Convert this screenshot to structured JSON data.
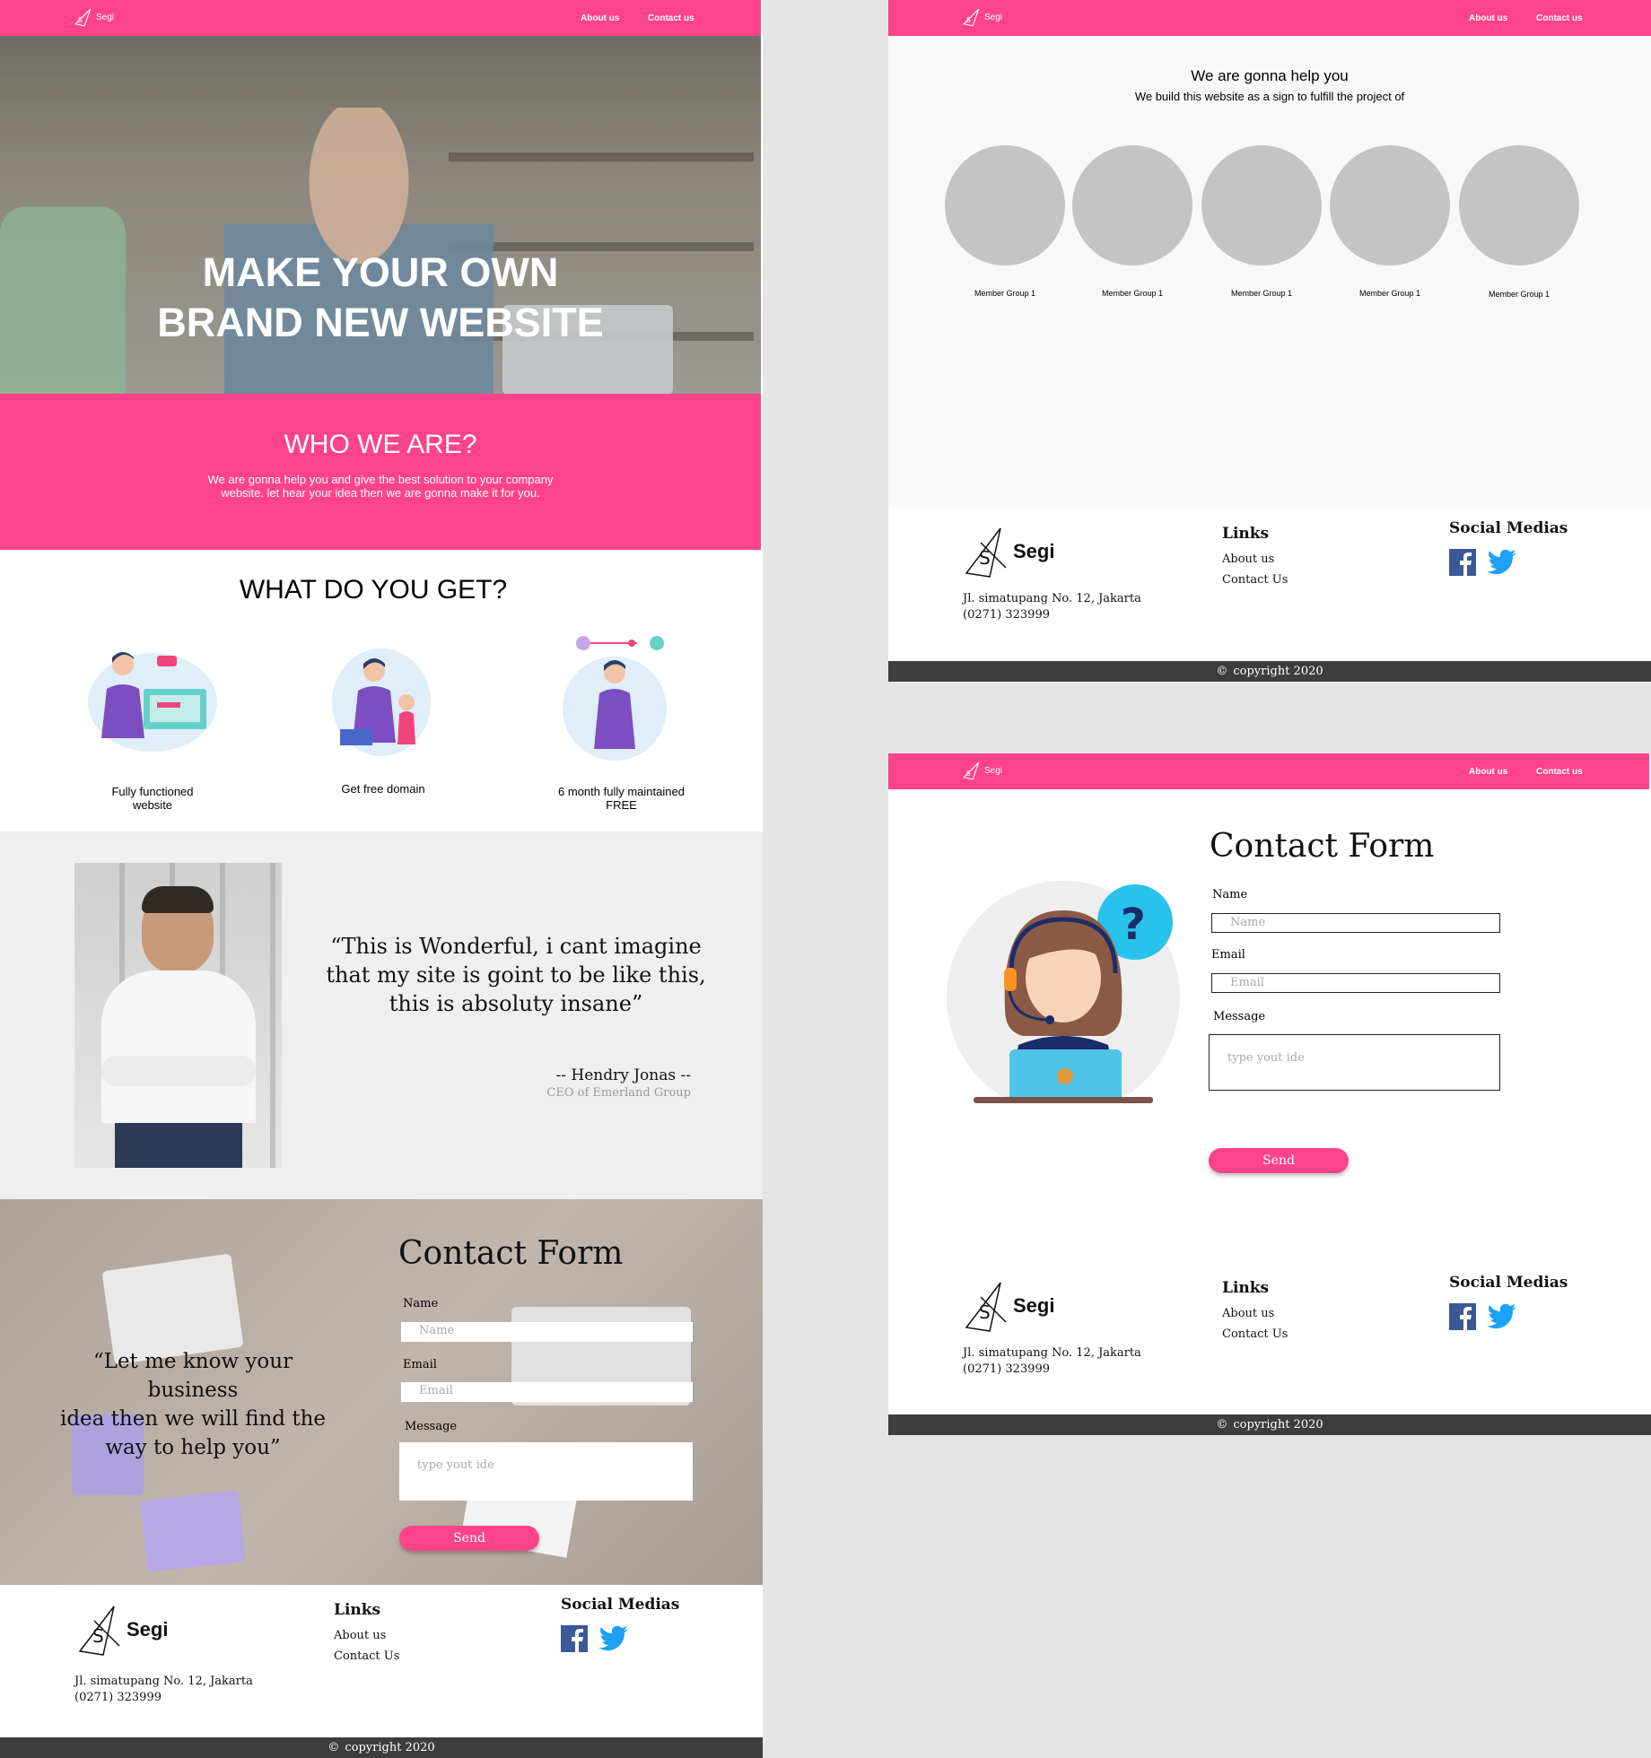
{
  "brand": {
    "name": "Segi"
  },
  "nav": {
    "about": "About  us",
    "contact": "Contact us"
  },
  "hero": {
    "line1": "MAKE YOUR OWN",
    "line2": "BRAND NEW WEBSITE"
  },
  "who": {
    "title": "WHO WE ARE?",
    "text1": "We are gonna help you and give the best solution to your company",
    "text2": "website. let hear your idea then we are gonna make it for you."
  },
  "get": {
    "title": "WHAT DO YOU GET?",
    "items": [
      {
        "line1": "Fully functioned",
        "line2": "website"
      },
      {
        "line1": "Get free domain",
        "line2": ""
      },
      {
        "line1": "6 month fully maintained",
        "line2": "FREE"
      }
    ]
  },
  "testimonial": {
    "line1": "“This is Wonderful, i cant imagine",
    "line2": "that my site is goint to be like this,",
    "line3": "this is absoluty insane”",
    "author": "-- Hendry Jonas --",
    "role": "CEO of Emerland Group"
  },
  "contact": {
    "title": "Contact Form",
    "quote1": "“Let me know your business",
    "quote2": "idea then we will find the",
    "quote3": "way to help you”",
    "name_label": "Name",
    "name_placeholder": "Name",
    "email_label": "Email",
    "email_placeholder": "Email",
    "message_label": "Message",
    "message_placeholder": "type yout ide",
    "send": "Send"
  },
  "team": {
    "title": "We are gonna help you",
    "subtitle": "We build this website as a sign to fulfill the project of",
    "members": [
      "Member Group 1",
      "Member Group 1",
      "Member Group 1",
      "Member Group 1",
      "Member Group 1"
    ]
  },
  "footer": {
    "address": "Jl. simatupang No. 12, Jakarta",
    "phone": "(0271) 323999",
    "links_title": "Links",
    "link_about": "About us",
    "link_contact": "Contact Us",
    "social_title": "Social Medias",
    "copyright": "copyright 2020"
  },
  "colors": {
    "accent": "#fd4389",
    "dark": "#3d3d3d",
    "facebook": "#3b5998",
    "twitter": "#1da1f2"
  }
}
